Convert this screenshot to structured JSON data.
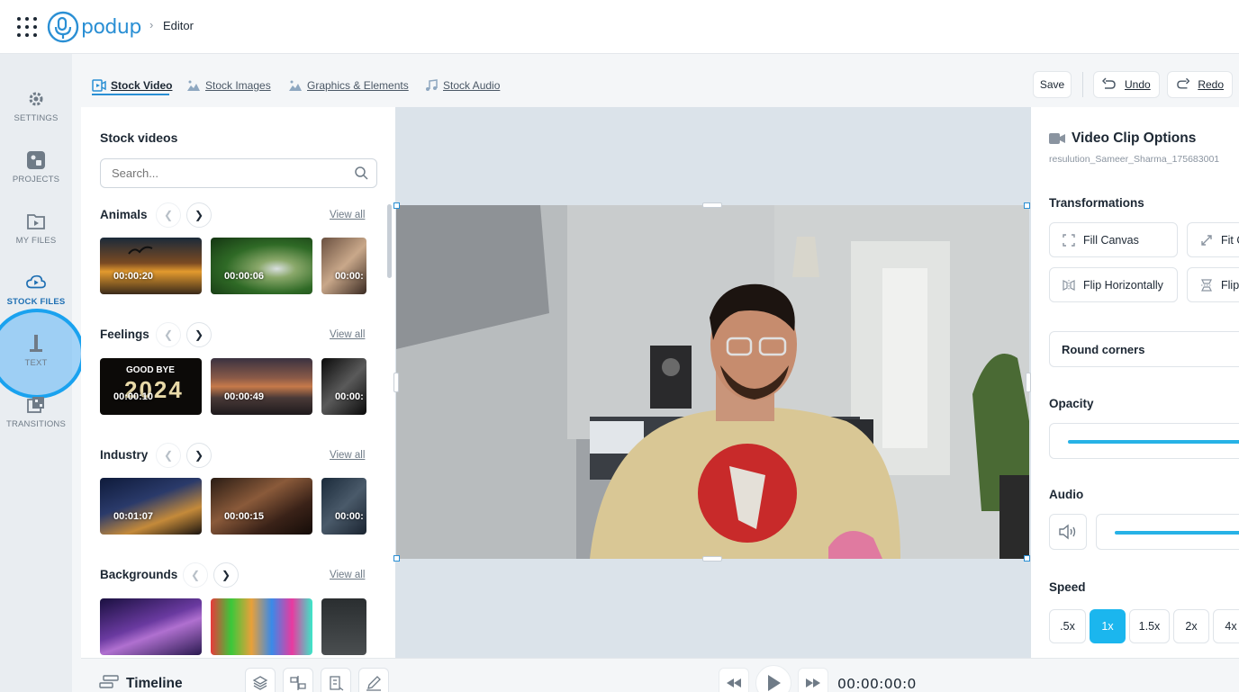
{
  "header": {
    "app_name": "podup",
    "breadcrumb_separator": "›",
    "breadcrumb_current": "Editor"
  },
  "leftnav": {
    "items": [
      {
        "label": "SETTINGS",
        "icon": "gear-icon"
      },
      {
        "label": "PROJECTS",
        "icon": "projects-icon"
      },
      {
        "label": "MY FILES",
        "icon": "video-file-icon"
      },
      {
        "label": "STOCK FILES",
        "icon": "cloud-icon"
      },
      {
        "label": "TEXT",
        "icon": "text-icon"
      },
      {
        "label": "TRANSITIONS",
        "icon": "transitions-icon"
      }
    ],
    "active": "STOCK FILES"
  },
  "tabs": [
    {
      "label": "Stock Video",
      "icon": "stock-video-icon",
      "active": true
    },
    {
      "label": "Stock Images",
      "icon": "image-icon",
      "active": false
    },
    {
      "label": "Graphics & Elements",
      "icon": "graphics-icon",
      "active": false
    },
    {
      "label": "Stock Audio",
      "icon": "music-note-icon",
      "active": false
    }
  ],
  "toolbar": {
    "save_label": "Save",
    "undo_label": "Undo",
    "redo_label": "Redo"
  },
  "stock_panel": {
    "title": "Stock videos",
    "search_placeholder": "Search...",
    "view_all_label": "View all",
    "categories": [
      {
        "name": "Animals",
        "thumbs": [
          "00:00:20",
          "00:00:06",
          "00:00:"
        ]
      },
      {
        "name": "Feelings",
        "thumbs": [
          "00:00:10",
          "00:00:49",
          "00:00:"
        ],
        "overlay_text": "GOOD BYE",
        "overlay_year": "2024"
      },
      {
        "name": "Industry",
        "thumbs": [
          "00:01:07",
          "00:00:15",
          "00:00:"
        ]
      },
      {
        "name": "Backgrounds",
        "thumbs": [
          "",
          "",
          ""
        ]
      }
    ]
  },
  "right_panel": {
    "title": "Video Clip Options",
    "filename": "resulution_Sameer_Sharma_175683001",
    "transformations_label": "Transformations",
    "buttons": {
      "fill_canvas": "Fill Canvas",
      "fit_canvas": "Fit C",
      "flip_h": "Flip Horizontally",
      "flip_v": "Flip"
    },
    "round_corners_label": "Round corners",
    "opacity_label": "Opacity",
    "opacity_value": 1.0,
    "audio_label": "Audio",
    "audio_value": 1.0,
    "speed_label": "Speed",
    "speed_options": [
      ".5x",
      "1x",
      "1.5x",
      "2x",
      "4x"
    ],
    "speed_selected": "1x"
  },
  "timeline": {
    "title": "Timeline",
    "time": "00:00:00:0"
  },
  "colors": {
    "accent": "#1bb6ee",
    "brand": "#2a8fd4",
    "highlight": "#1aa2ef"
  }
}
